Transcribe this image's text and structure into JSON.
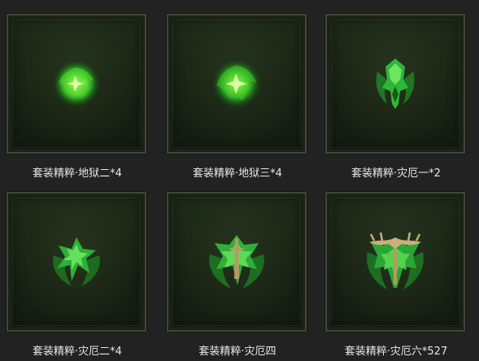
{
  "items": [
    {
      "label": "套装精粹·地狱二*4",
      "icon": "green-orb-icon"
    },
    {
      "label": "套装精粹·地狱三*4",
      "icon": "green-orb-icon"
    },
    {
      "label": "套装精粹·灾厄一*2",
      "icon": "green-emblem-small-icon"
    },
    {
      "label": "套装精粹·灾厄二*4",
      "icon": "green-cross-emblem-icon"
    },
    {
      "label": "套装精粹·灾厄四",
      "icon": "green-thorn-emblem-icon"
    },
    {
      "label": "套装精粹·灾厄六*527",
      "icon": "green-bone-crest-icon"
    }
  ],
  "colors": {
    "background": "#222222",
    "label_text": "#e8e8e8",
    "glow": "#6bff3a",
    "frame_border": "#3d4a35"
  }
}
